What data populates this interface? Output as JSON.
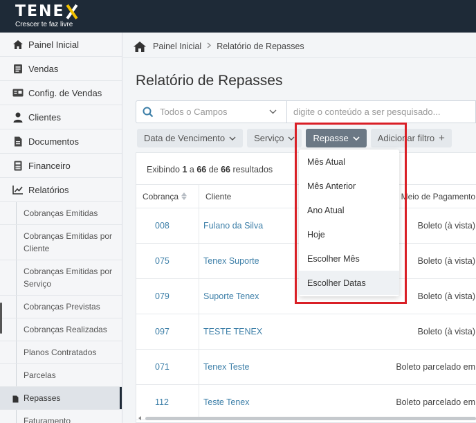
{
  "brand": {
    "name": "TENE",
    "name_x": "X",
    "tagline": "Crescer te faz livre"
  },
  "sidebar": {
    "items": [
      {
        "label": "Painel Inicial",
        "icon": "home-icon"
      },
      {
        "label": "Vendas",
        "icon": "cart-icon"
      },
      {
        "label": "Config. de Vendas",
        "icon": "card-icon"
      },
      {
        "label": "Clientes",
        "icon": "user-icon"
      },
      {
        "label": "Documentos",
        "icon": "document-icon"
      },
      {
        "label": "Financeiro",
        "icon": "calculator-icon"
      },
      {
        "label": "Relatórios",
        "icon": "chart-line-icon"
      }
    ],
    "reports": [
      "Cobranças Emitidas",
      "Cobranças Emitidas por Cliente",
      "Cobranças Emitidas por Serviço",
      "Cobranças Previstas",
      "Cobranças Realizadas",
      "Planos Contratados",
      "Parcelas",
      "Repasses",
      "Faturamento"
    ],
    "active": "Repasses"
  },
  "breadcrumb": {
    "home": "Painel Inicial",
    "current": "Relatório de Repasses"
  },
  "page": {
    "title": "Relatório de Repasses"
  },
  "search": {
    "field_select": "Todos o Campos",
    "placeholder": "digite o conteúdo a ser pesquisado..."
  },
  "filters": [
    {
      "label": "Data de Vencimento",
      "active": false
    },
    {
      "label": "Serviço",
      "active": false
    },
    {
      "label": "Repasse",
      "active": true
    },
    {
      "label": "Adicionar filtro",
      "active": false
    }
  ],
  "results": {
    "prefix": "Exibindo",
    "from": "1",
    "sep": "a",
    "to": "66",
    "of": "de",
    "total": "66",
    "suffix": "resultados"
  },
  "table": {
    "columns": [
      "Cobrança",
      "Cliente",
      "Meio de Pagamento"
    ],
    "rows": [
      {
        "cobranca": "008",
        "cliente": "Fulano da Silva",
        "meio": "Boleto (à vista)"
      },
      {
        "cobranca": "075",
        "cliente": "Tenex Suporte",
        "meio": "Boleto (à vista)"
      },
      {
        "cobranca": "079",
        "cliente": "Suporte Tenex",
        "meio": "Boleto (à vista)"
      },
      {
        "cobranca": "097",
        "cliente": "TESTE TENEX",
        "meio": "Boleto (à vista)"
      },
      {
        "cobranca": "071",
        "cliente": "Tenex Teste",
        "meio": "Boleto parcelado em"
      },
      {
        "cobranca": "112",
        "cliente": "Teste Tenex",
        "meio": "Boleto parcelado em"
      }
    ]
  },
  "repasse_dropdown": {
    "options": [
      "Mês Atual",
      "Mês Anterior",
      "Ano Atual",
      "Hoje",
      "Escolher Mês",
      "Escolher Datas"
    ],
    "hovered": "Escolher Datas"
  },
  "colors": {
    "topbar": "#1e2a37",
    "link": "#3d7fa8",
    "highlight": "#d91f26",
    "chip_active": "#6b7885"
  }
}
